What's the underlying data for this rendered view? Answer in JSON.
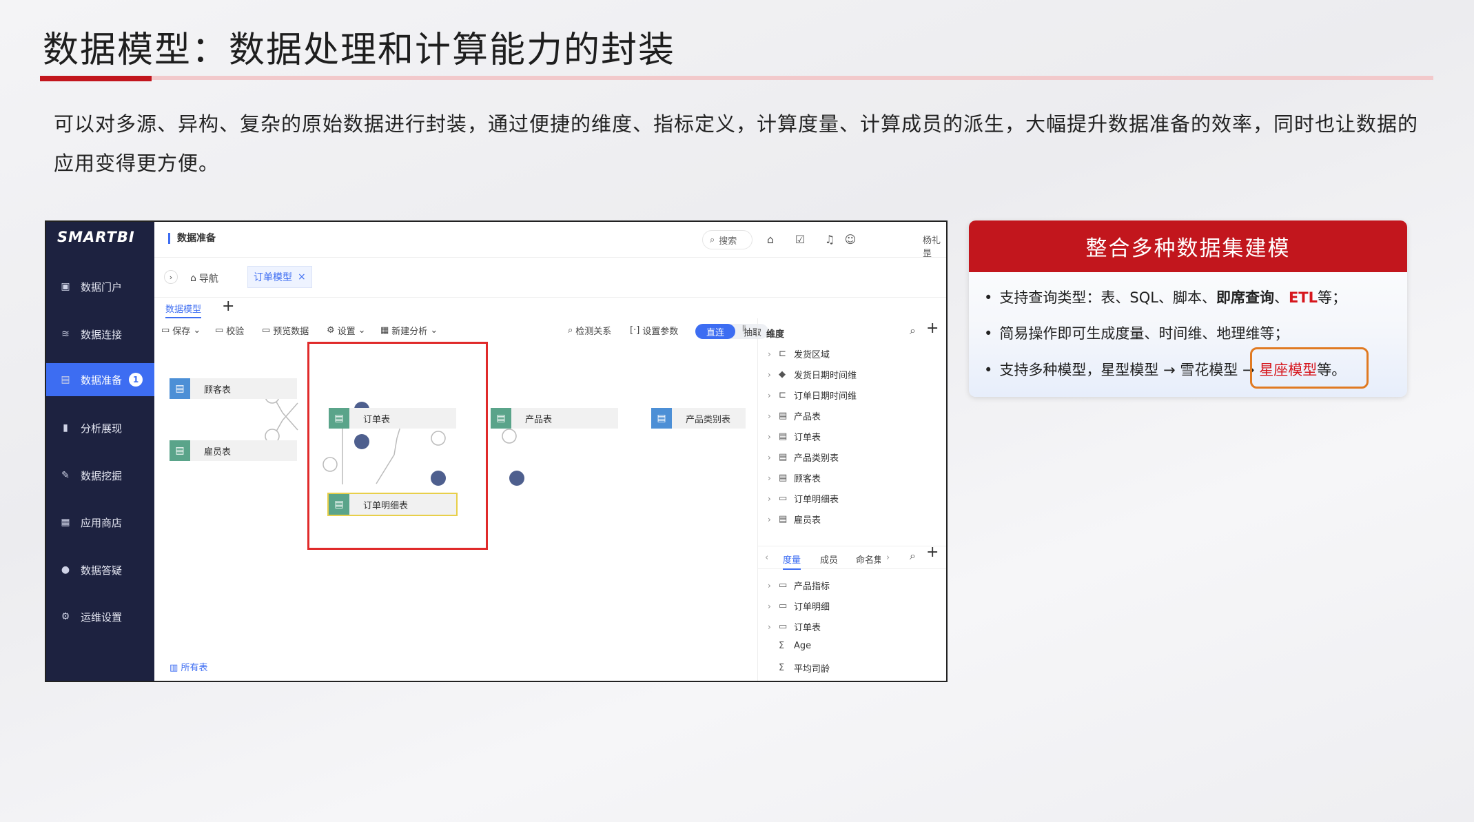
{
  "slide": {
    "title": "数据模型：数据处理和计算能力的封装",
    "intro": "可以对多源、异构、复杂的原始数据进行封装，通过便捷的维度、指标定义，计算度量、计算成员的派生，大幅提升数据准备的效率，同时也让数据的应用变得更方便。"
  },
  "app": {
    "logo": "SMARTBI",
    "nav": [
      {
        "label": "数据门户",
        "icon": "portal-icon"
      },
      {
        "label": "数据连接",
        "icon": "database-icon"
      },
      {
        "label": "数据准备",
        "icon": "prepare-icon",
        "badge": "1",
        "active": true
      },
      {
        "label": "分析展现",
        "icon": "bar-chart-icon"
      },
      {
        "label": "数据挖掘",
        "icon": "pick-icon"
      },
      {
        "label": "应用商店",
        "icon": "grid-icon"
      },
      {
        "label": "数据答疑",
        "icon": "question-icon"
      },
      {
        "label": "运维设置",
        "icon": "gear-icon"
      }
    ],
    "header": {
      "breadcrumb": "数据准备",
      "search": "搜索",
      "user": "杨礼昰"
    },
    "tabs": {
      "nav": "导航",
      "model": "订单模型"
    },
    "subtab": "数据模型",
    "toolbar": {
      "save": "保存",
      "check": "校验",
      "preview": "预览数据",
      "settings": "设置",
      "new_analysis": "新建分析",
      "detect": "检测关系",
      "params": "设置参数",
      "direct": "直连",
      "extract": "抽取"
    },
    "nodes": {
      "customer": "顾客表",
      "employee": "雇员表",
      "order": "订单表",
      "order_detail": "订单明细表",
      "product": "产品表",
      "product_category": "产品类别表"
    },
    "all_tables": "所有表",
    "dimension_header": "维度",
    "dimensions": [
      "发货区域",
      "发货日期时间维",
      "订单日期时间维",
      "产品表",
      "订单表",
      "产品类别表",
      "顾客表",
      "订单明细表",
      "雇员表"
    ],
    "measure_tabs": [
      "度量",
      "成员",
      "命名集"
    ],
    "measures": [
      "产品指标",
      "订单明细",
      "订单表",
      "Age",
      "平均司龄"
    ]
  },
  "card": {
    "title": "整合多种数据集建模",
    "b1_pre": "支持查询类型：表、SQL、脚本、",
    "b1_bold": "即席查询",
    "b1_sep": "、",
    "b1_red": "ETL",
    "b1_post": "等；",
    "b2": "简易操作即可生成度量、时间维、地理维等；",
    "b3_pre": "支持多种模型，星型模型 → 雪花模型 → ",
    "b3_red": "星座模型",
    "b3_post": "等。"
  }
}
